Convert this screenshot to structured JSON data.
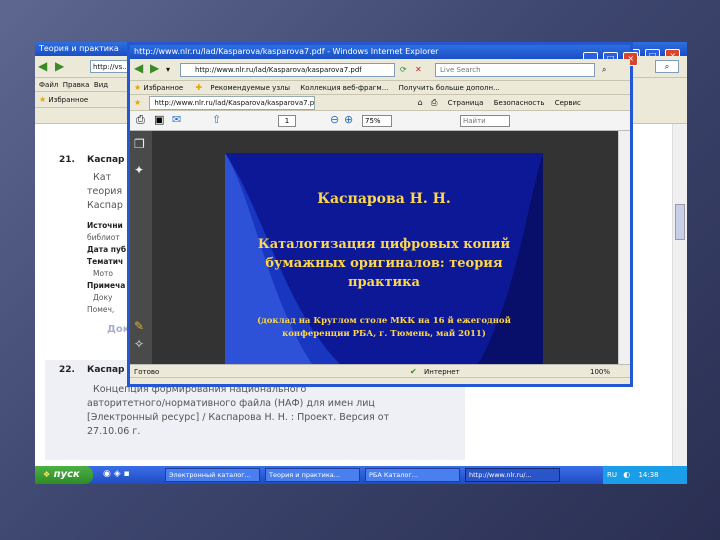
{
  "back_window": {
    "title": "Теория и практика",
    "address": "http://vs...",
    "menu": [
      "Файл",
      "Правка",
      "Вид"
    ],
    "fav_label": "Избранное",
    "entries": [
      {
        "num": "21.",
        "title": "Каспар",
        "lines": [
          "Кат",
          "теория",
          "Каспар"
        ],
        "fields": [
          "Источни",
          "библиот",
          "Дата пуб",
          "Тематич",
          "Мото",
          "Примеча",
          "Доку",
          "Помеч,"
        ],
        "link": "Док"
      },
      {
        "num": "22.",
        "title": "Каспар",
        "lines": [
          "Концепция формирования национального",
          "авторитетного/нормативного файла (НАФ) для имен лиц",
          "[Электронный ресурс] / Каспарова Н. Н. : Проект. Версия от",
          "27.10.06 г."
        ]
      }
    ]
  },
  "ie_window": {
    "title": "http://www.nlr.ru/lad/Kasparova/kasparova7.pdf - Windows Internet Explorer",
    "address": "http://www.nlr.ru/lad/Kasparova/kasparova7.pdf",
    "search_placeholder": "Live Search",
    "favorites_label": "Избранное",
    "links": [
      "Рекомендуемые узлы",
      "Коллекция веб-фрагм...",
      "Получить больше дополн..."
    ],
    "tab_label": "http://www.nlr.ru/lad/Kasparova/kasparova7.pdf",
    "tools": [
      "Страница",
      "Безопасность",
      "Сервис"
    ],
    "pdf_find": "Найти",
    "zoom": "75%",
    "page_number": "1",
    "status_left": "Готово",
    "status_zone": "Интернет",
    "status_zoom": "100%"
  },
  "slide": {
    "author": "Каспарова Н. Н.",
    "title_lines": [
      "Каталогизация цифровых копий",
      "бумажных оригиналов: теория",
      "практика"
    ],
    "note_lines": [
      "(доклад на Круглом столе МКК на 16 й ежегодной",
      "конференции РБА, г. Тюмень, май 2011)"
    ]
  },
  "taskbar": {
    "start": "пуск",
    "items": [
      "Электронный каталог...",
      "Теория и практика...",
      "РБА Каталог...",
      "http://www.nlr.ru/..."
    ],
    "lang": "RU",
    "clock": "14:38"
  },
  "colors": {
    "slide_bg": "#0c1896",
    "slide_title": "#ffd84a",
    "xp_blue": "#2d6fe0",
    "taskbar": "#2452c8",
    "start_green": "#3c9c34"
  }
}
